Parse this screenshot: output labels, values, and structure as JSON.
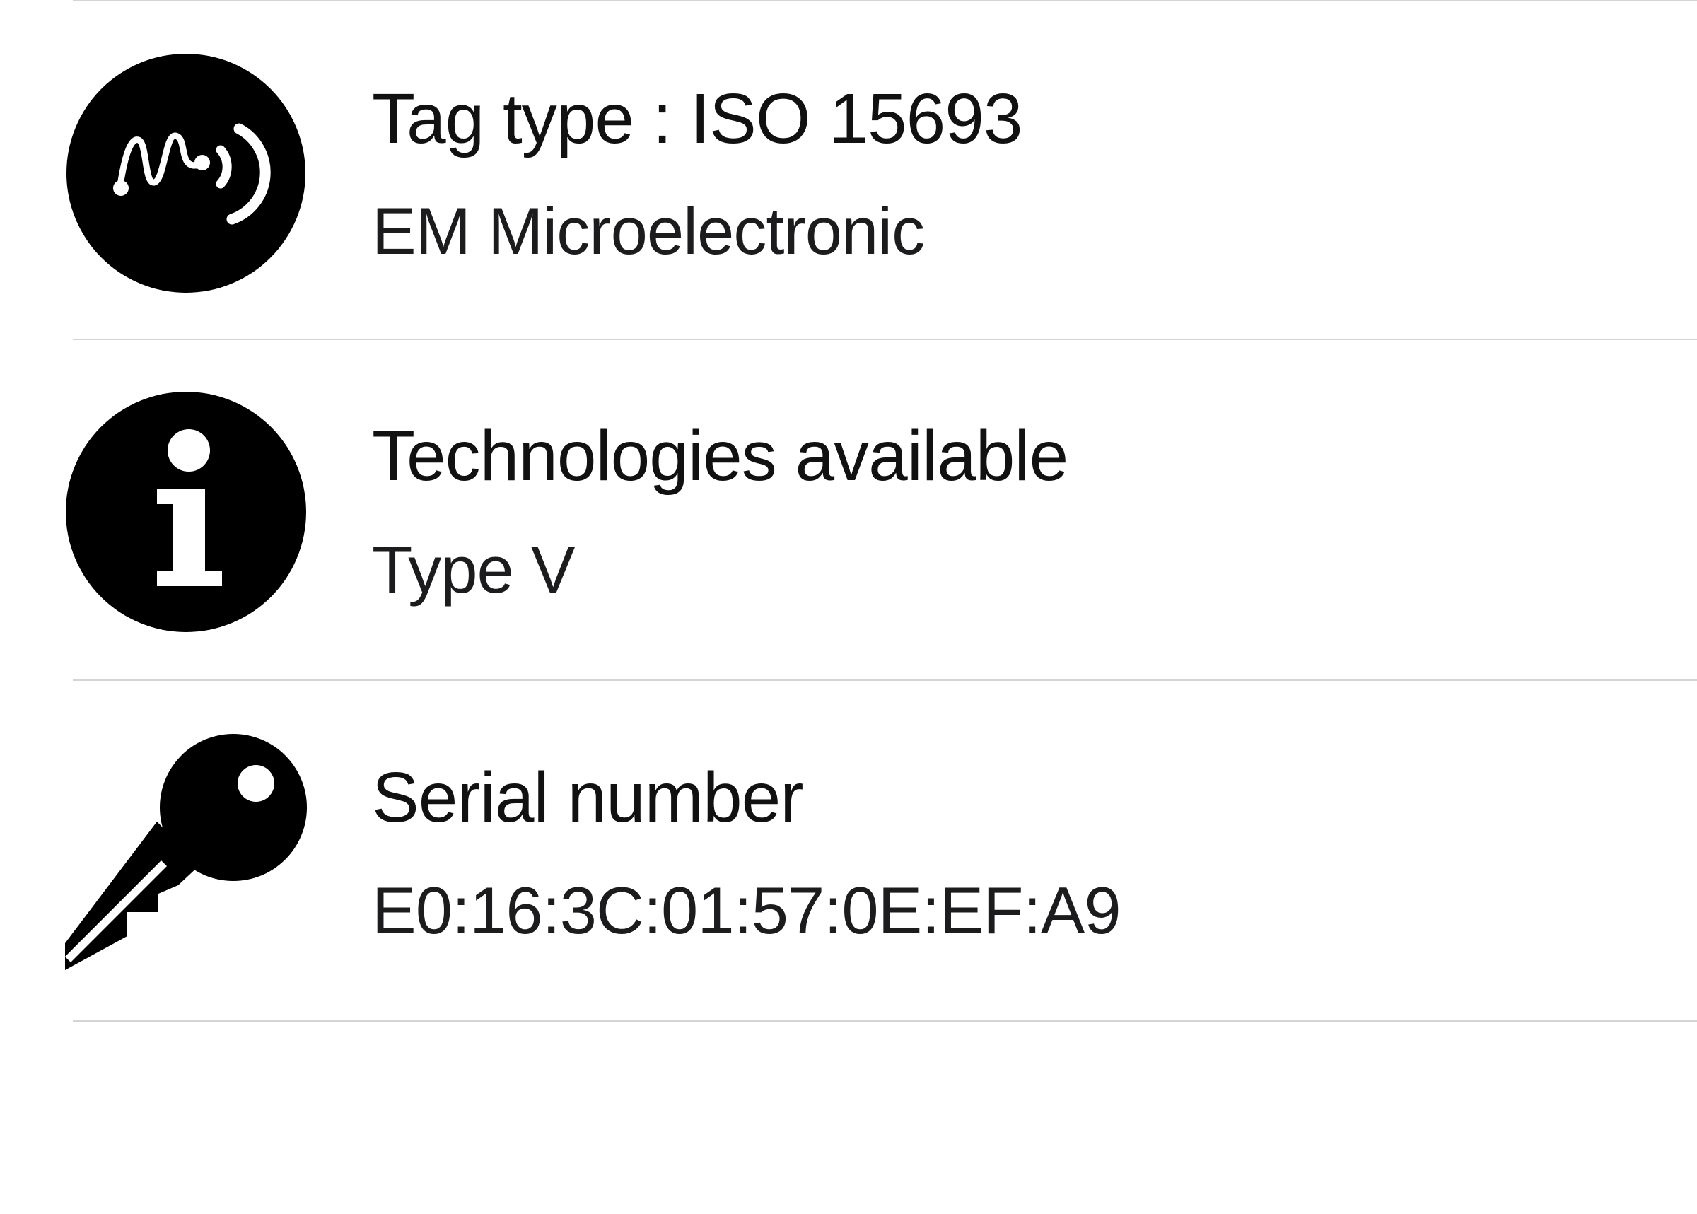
{
  "items": [
    {
      "title": "Tag type : ISO 15693",
      "subtitle": "EM Microelectronic",
      "icon": "nfc-wave-icon"
    },
    {
      "title": "Technologies available",
      "subtitle": "Type V",
      "icon": "info-icon"
    },
    {
      "title": "Serial number",
      "subtitle": "E0:16:3C:01:57:0E:EF:A9",
      "icon": "key-icon"
    }
  ],
  "colors": {
    "icon": "#000000",
    "text": "#111111",
    "separator": "#d4d4d6",
    "background": "#ffffff"
  }
}
